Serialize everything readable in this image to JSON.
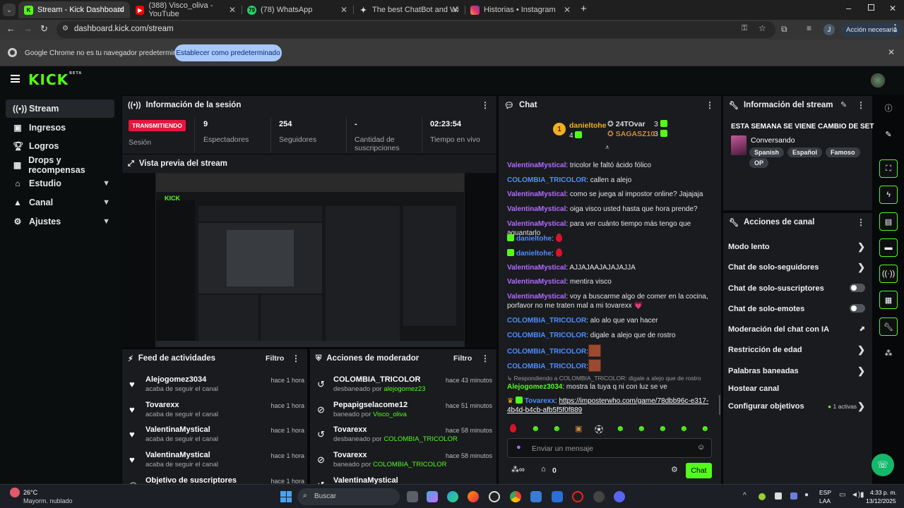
{
  "browser": {
    "tabs": [
      {
        "title": "Stream - Kick Dashboard",
        "active": true
      },
      {
        "title": "(388) Visco_oliva - YouTube",
        "active": false
      },
      {
        "title": "(78) WhatsApp",
        "active": false
      },
      {
        "title": "The best ChatBot and Widgets",
        "active": false
      },
      {
        "title": "Historias • Instagram",
        "active": false
      }
    ],
    "url": "dashboard.kick.com/stream",
    "profile_initial": "J",
    "action_needed": "Acción necesaria",
    "infobar_text": "Google Chrome no es tu navegador predeterminado",
    "infobar_button": "Establecer como predeterminado"
  },
  "kick": {
    "logo": "KICK",
    "logo_sup": "BETA"
  },
  "sidebar": {
    "items": [
      {
        "label": "Stream",
        "icon": "broadcast-icon"
      },
      {
        "label": "Ingresos",
        "icon": "revenue-icon"
      },
      {
        "label": "Logros",
        "icon": "trophy-icon"
      },
      {
        "label": "Drops y recompensas",
        "icon": "gift-icon"
      },
      {
        "label": "Estudio",
        "icon": "studio-icon"
      },
      {
        "label": "Canal",
        "icon": "channel-icon"
      },
      {
        "label": "Ajustes",
        "icon": "gear-icon"
      }
    ]
  },
  "session": {
    "title": "Información de la sesión",
    "status_badge": "TRANSMITIENDO",
    "status_label": "Sesión",
    "viewers": "9",
    "viewers_label": "Espectadores",
    "followers": "254",
    "followers_label": "Seguidores",
    "subs": "-",
    "subs_label": "Cantidad de suscripciones",
    "uptime": "02:23:54",
    "uptime_label": "Tiempo en vivo"
  },
  "preview": {
    "title": "Vista previa del stream"
  },
  "feed": {
    "title": "Feed de actividades",
    "filter": "Filtro",
    "items": [
      {
        "name": "Alejogomez3034",
        "sub": "acaba de seguir el canal",
        "time": "hace 1 hora"
      },
      {
        "name": "Tovarexx",
        "sub": "acaba de seguir el canal",
        "time": "hace 1 hora"
      },
      {
        "name": "ValentinaMystical",
        "sub": "acaba de seguir el canal",
        "time": "hace 1 hora"
      },
      {
        "name": "ValentinaMystical",
        "sub": "acaba de seguir el canal",
        "time": "hace 1 hora"
      },
      {
        "name": "Objetivo de suscriptores",
        "sub": "",
        "time": "hace 1 hora"
      }
    ]
  },
  "mod": {
    "title": "Acciones de moderador",
    "filter": "Filtro",
    "items": [
      {
        "name": "COLOMBIA_TRICOLOR",
        "sub": "desbaneado por",
        "by": "alejogomez23",
        "time": "hace 43 minutos",
        "icon": "unban-icon"
      },
      {
        "name": "Pepapigselacome12",
        "sub": "baneado por",
        "by": "Visco_oliva",
        "time": "hace 51 minutos",
        "icon": "ban-icon"
      },
      {
        "name": "Tovarexx",
        "sub": "desbaneado por",
        "by": "COLOMBIA_TRICOLOR",
        "time": "hace 58 minutos",
        "icon": "unban-icon"
      },
      {
        "name": "Tovarexx",
        "sub": "baneado por",
        "by": "COLOMBIA_TRICOLOR",
        "time": "hace 58 minutos",
        "icon": "ban-icon"
      },
      {
        "name": "ValentinaMystical",
        "sub": "",
        "by": "",
        "time": "",
        "icon": "unban-icon"
      }
    ]
  },
  "chat": {
    "title": "Chat",
    "top1": {
      "rank": "1",
      "name": "danieltohe",
      "count": "4"
    },
    "top2": {
      "name": "24TOvar",
      "count": "3"
    },
    "top3": {
      "name": "SAGASZ10",
      "count": "3"
    },
    "messages": [
      {
        "user": "ValentinaMystical",
        "color": "purple",
        "text": ": tricolor le faltó ácido fólico"
      },
      {
        "user": "COLOMBIA_TRICOLOR",
        "color": "blue",
        "text": ": callen a alejo"
      },
      {
        "user": "ValentinaMystical",
        "color": "purple",
        "text": ": como se juega al impostor online? Jajajaja"
      },
      {
        "user": "ValentinaMystical",
        "color": "purple",
        "text": ": oiga visco usted hasta que hora prende?"
      },
      {
        "user": "ValentinaMystical",
        "color": "purple",
        "text": ": para ver cuánto tiempo más tengo que aguantarlo"
      },
      {
        "user": "danieltohe",
        "color": "green",
        "text": ":"
      },
      {
        "user": "danieltohe",
        "color": "green",
        "text": ":"
      },
      {
        "user": "ValentinaMystical",
        "color": "purple",
        "text": ": AJJAJAAJAJAJAJJA"
      },
      {
        "user": "ValentinaMystical",
        "color": "purple",
        "text": ": mentira visco"
      },
      {
        "user": "ValentinaMystical",
        "color": "purple",
        "text": ": voy a buscarme algo de comer en la cocina, porfavor no me traten mal a mi tovarexx 💗"
      },
      {
        "user": "COLOMBIA_TRICOLOR",
        "color": "blue",
        "text": ": alo alo que van hacer"
      },
      {
        "user": "COLOMBIA_TRICOLOR",
        "color": "blue",
        "text": ": digale a alejo que de rostro"
      },
      {
        "user": "COLOMBIA_TRICOLOR",
        "color": "blue",
        "text": ":"
      },
      {
        "user": "COLOMBIA_TRICOLOR",
        "color": "blue",
        "text": ":"
      }
    ],
    "reply_ref": "Respondiendo a COLOMBIA_TRICOLOR: digale a alejo que de rostro",
    "reply_user": "Alejogomez3034",
    "reply_text": ": mostra la tuya q ni con luz se ve",
    "link_user": "Tovarexx",
    "link_text": "https://imposterwho.com/game/78dbb96c-e317-4b4d-b4cb-afb5f5f0f889",
    "input_placeholder": "Enviar un mensaje",
    "count": "0",
    "send": "Chat"
  },
  "stream_info": {
    "title": "Información del stream",
    "stream_title": "ESTA SEMANA SE VIENE CAMBIO DE SET",
    "category": "Conversando",
    "tags": [
      "Spanish",
      "Español",
      "Famoso",
      "OP"
    ]
  },
  "channel_actions": {
    "title": "Acciones de canal",
    "items": [
      {
        "label": "Modo lento",
        "control": "arrow"
      },
      {
        "label": "Chat de solo-seguidores",
        "control": "arrow"
      },
      {
        "label": "Chat de solo-suscriptores",
        "control": "toggle"
      },
      {
        "label": "Chat de solo-emotes",
        "control": "toggle"
      },
      {
        "label": "Moderación del chat con IA",
        "control": "external"
      },
      {
        "label": "Restricción de edad",
        "control": "arrow"
      },
      {
        "label": "Palabras baneadas",
        "control": "arrow"
      },
      {
        "label": "Hostear canal",
        "control": "none"
      },
      {
        "label": "Configurar objetivos",
        "control": "arrow",
        "extra": "1 activas"
      }
    ]
  },
  "taskbar": {
    "weather_temp": "26°C",
    "weather_desc": "Mayorm. nublado",
    "search": "Buscar",
    "lang": "ESP",
    "lang2": "LAA",
    "time": "4:33 p. m.",
    "date": "13/12/2025"
  },
  "colors": {
    "kick_green": "#53fc18",
    "live_red": "#e5173f",
    "panel": "#191b1f"
  }
}
